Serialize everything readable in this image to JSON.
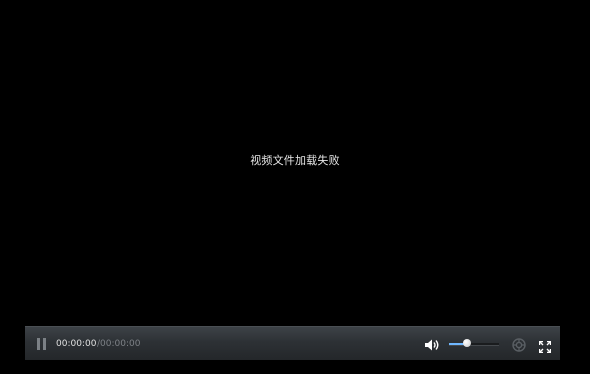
{
  "player": {
    "error_message": "视频文件加载失败",
    "controls": {
      "current_time": "00:00:00",
      "total_time": "/00:00:00",
      "volume_level": 0.35,
      "icons": {
        "play_pause": "pause-icon",
        "volume": "volume-icon",
        "settings": "settings-icon",
        "fullscreen": "fullscreen-icon"
      },
      "accent_color": "#6fb7ff"
    }
  }
}
